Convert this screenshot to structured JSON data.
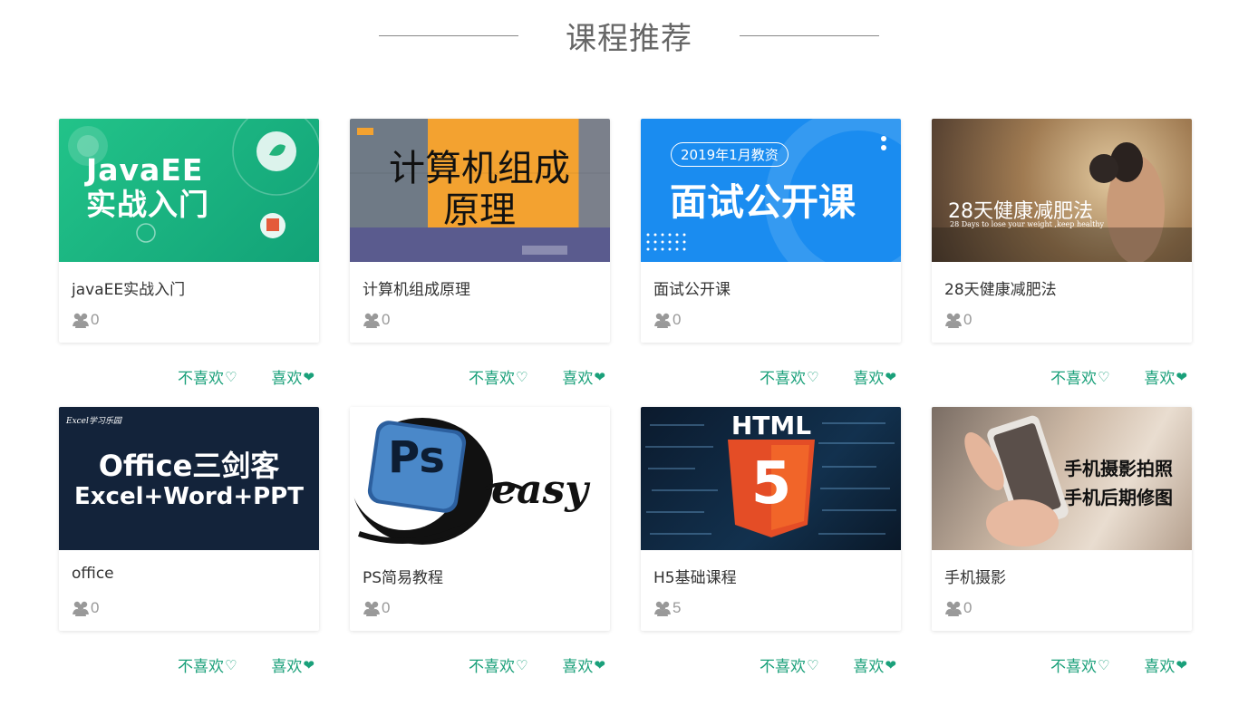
{
  "page": {
    "section_title": "课程推荐"
  },
  "colors": {
    "accent": "#1aa07a",
    "title_gray": "#666666"
  },
  "icons": {
    "students": "users-icon",
    "dislike": "heart-outline-icon",
    "like": "heart-filled-icon"
  },
  "courses": [
    {
      "title": "javaEE实战入门",
      "students": "0",
      "thumb_text": [
        "JavaEE",
        "实战入门"
      ],
      "dislike": "不喜欢",
      "like": "喜欢"
    },
    {
      "title": "计算机组成原理",
      "students": "0",
      "thumb_text": [
        "计算机组成",
        "原理"
      ],
      "dislike": "不喜欢",
      "like": "喜欢"
    },
    {
      "title": "面试公开课",
      "students": "0",
      "thumb_text": [
        "2019年1月教资",
        "面试公开课"
      ],
      "dislike": "不喜欢",
      "like": "喜欢"
    },
    {
      "title": "28天健康减肥法",
      "students": "0",
      "thumb_text": [
        "28天健康减肥法",
        "28 Days to lose your weight ,keep healthy"
      ],
      "dislike": "不喜欢",
      "like": "喜欢"
    },
    {
      "title": "office",
      "students": "0",
      "thumb_text": [
        "Excel学习乐园",
        "Office三剑客",
        "Excel+Word+PPT"
      ],
      "dislike": "不喜欢",
      "like": "喜欢"
    },
    {
      "title": "PS简易教程",
      "students": "0",
      "thumb_text": [
        "Ps",
        "easy"
      ],
      "dislike": "不喜欢",
      "like": "喜欢"
    },
    {
      "title": "H5基础课程",
      "students": "5",
      "thumb_text": [
        "HTML",
        "5"
      ],
      "dislike": "不喜欢",
      "like": "喜欢"
    },
    {
      "title": "手机摄影",
      "students": "0",
      "thumb_text": [
        "手机摄影拍照",
        "手机后期修图"
      ],
      "dislike": "不喜欢",
      "like": "喜欢"
    }
  ]
}
